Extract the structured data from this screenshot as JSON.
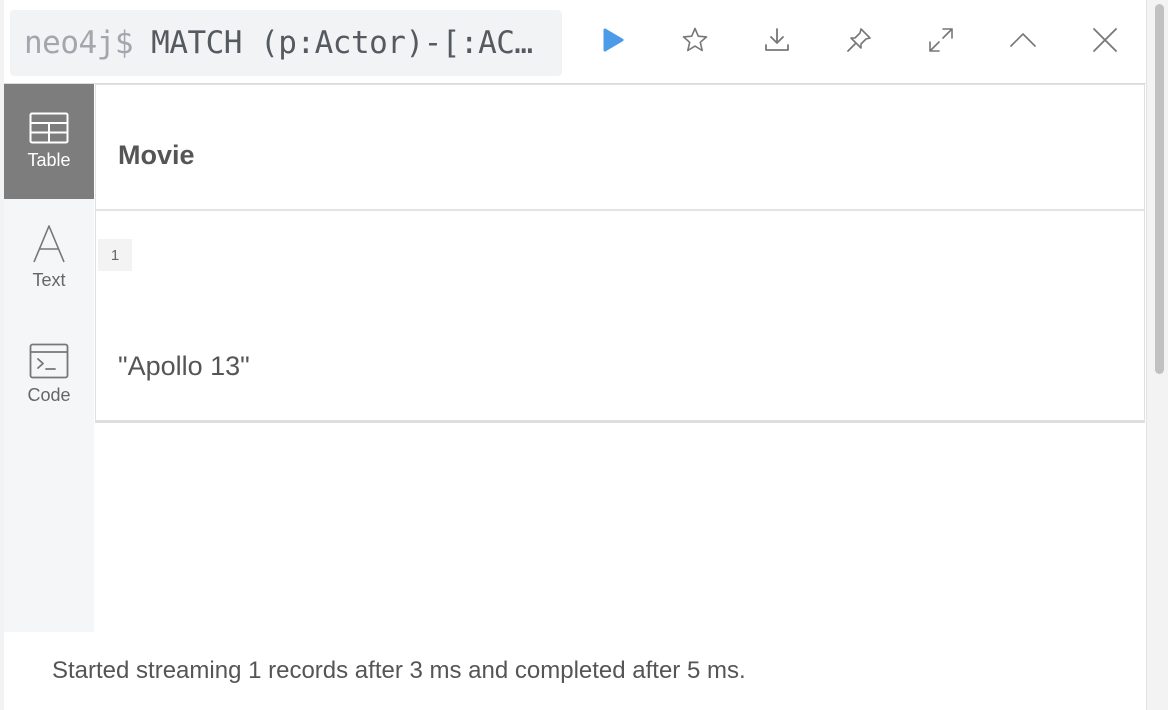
{
  "query_bar": {
    "prompt": "neo4j$",
    "query_text": "MATCH (p:Actor)-[:AC…"
  },
  "toolbar": {
    "icons": [
      "run-icon",
      "star-icon",
      "download-icon",
      "pin-icon",
      "expand-icon",
      "collapse-icon",
      "close-icon"
    ],
    "run_color": "#4c9be8"
  },
  "sidebar": {
    "items": [
      {
        "label": "Table",
        "icon": "table-icon",
        "active": true
      },
      {
        "label": "Text",
        "icon": "text-icon",
        "active": false
      },
      {
        "label": "Code",
        "icon": "code-icon",
        "active": false
      }
    ]
  },
  "result": {
    "columns": [
      "Movie"
    ],
    "rows": [
      {
        "index": "1",
        "cells": [
          "\"Apollo 13\""
        ]
      }
    ]
  },
  "status": "Started streaming 1 records after 3 ms and completed after 5 ms."
}
